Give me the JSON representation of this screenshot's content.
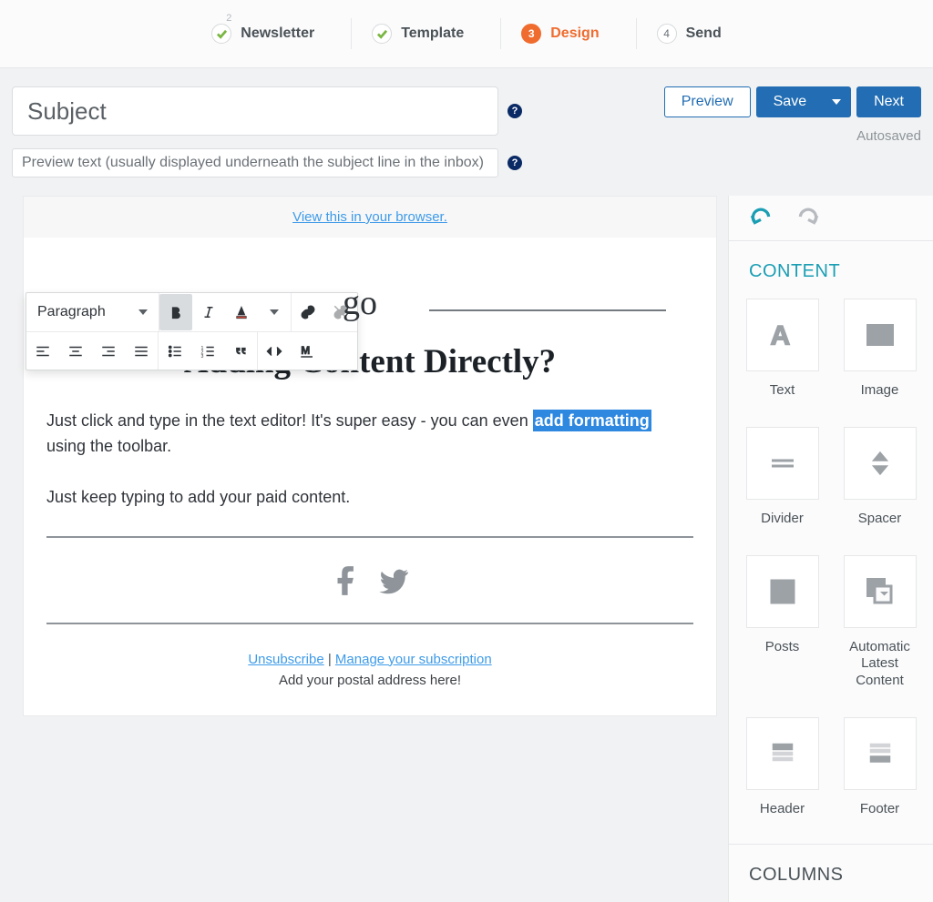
{
  "stepper": {
    "steps": [
      {
        "label": "Newsletter",
        "check": true,
        "super": "2"
      },
      {
        "label": "Template",
        "check": true
      },
      {
        "label": "Design",
        "num": "3",
        "current": true
      },
      {
        "label": "Send",
        "num": "4"
      }
    ]
  },
  "header": {
    "subject_placeholder": "Subject",
    "preview_placeholder": "Preview text (usually displayed underneath the subject line in the inbox)",
    "preview_btn": "Preview",
    "save_btn": "Save",
    "next_btn": "Next",
    "autosaved": "Autosaved",
    "help": "?"
  },
  "toolbar": {
    "style_select": "Paragraph"
  },
  "email": {
    "browser_link": "View this in your browser.",
    "logo_text": "go",
    "headline": "Adding Content Directly?",
    "para1_a": "Just click and type in the text editor! It's super easy - you can even ",
    "para1_hl": "add formatting",
    "para1_b": " using the toolbar.",
    "para2": "Just keep typing to add your paid content.",
    "unsubscribe": "Unsubscribe",
    "pipe": " | ",
    "manage": "Manage your subscription",
    "postal": "Add your postal address here!"
  },
  "sidebar": {
    "content_title": "CONTENT",
    "columns_title": "COLUMNS",
    "blocks": {
      "text": "Text",
      "image": "Image",
      "divider": "Divider",
      "spacer": "Spacer",
      "posts": "Posts",
      "alc": "Automatic Latest Content",
      "header": "Header",
      "footer": "Footer"
    }
  }
}
